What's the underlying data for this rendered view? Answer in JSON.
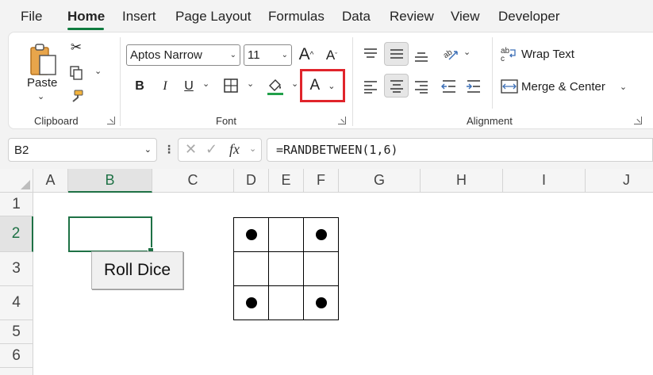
{
  "tabs": [
    "File",
    "Home",
    "Insert",
    "Page Layout",
    "Formulas",
    "Data",
    "Review",
    "View",
    "Developer"
  ],
  "active_tab": "Home",
  "clipboard": {
    "paste_label": "Paste",
    "group_label": "Clipboard"
  },
  "font": {
    "name": "Aptos Narrow",
    "size": "11",
    "group_label": "Font",
    "bold": "B",
    "italic": "I",
    "underline": "U",
    "font_color_glyph": "A",
    "grow_glyph": "A",
    "shrink_glyph": "A"
  },
  "alignment": {
    "wrap_text": "Wrap Text",
    "merge_center": "Merge & Center",
    "group_label": "Alignment"
  },
  "formula_bar": {
    "name_box": "B2",
    "fx": "fx",
    "formula": "=RANDBETWEEN(1,6)"
  },
  "columns": [
    "A",
    "B",
    "C",
    "D",
    "E",
    "F",
    "G",
    "H",
    "I",
    "J"
  ],
  "rows": [
    "1",
    "2",
    "3",
    "4",
    "5",
    "6"
  ],
  "selected_cell": {
    "column": "B",
    "row": "2"
  },
  "roll_button_label": "Roll Dice",
  "dice_pips": [
    true,
    false,
    true,
    false,
    false,
    false,
    true,
    false,
    true
  ],
  "colors": {
    "accent": "#1e7145",
    "highlight_box": "#e0242b",
    "fill_color_bar": "#21a04a",
    "font_color_bar": "#e0242b"
  }
}
